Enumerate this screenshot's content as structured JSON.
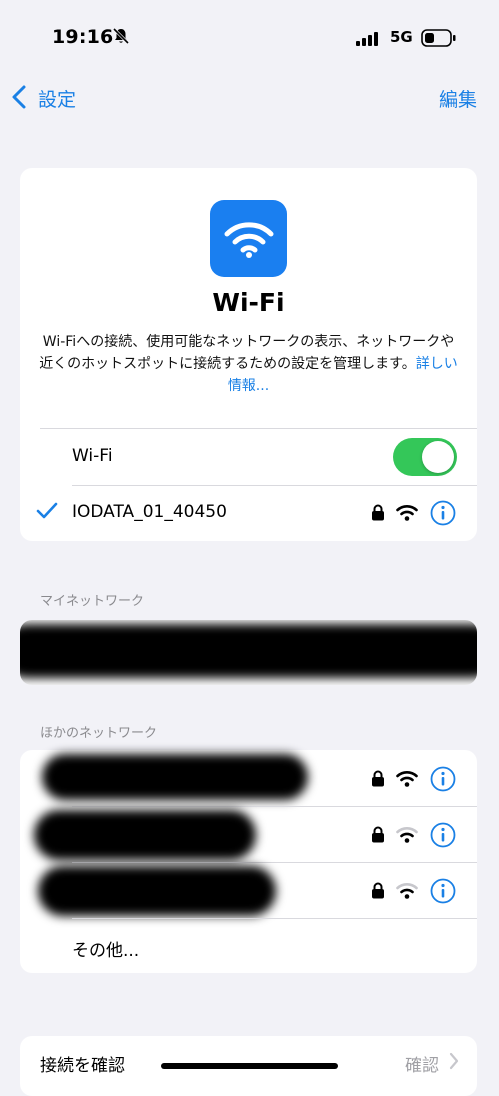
{
  "status_bar": {
    "time": "19:16",
    "network": "5G",
    "icons": [
      "bell-slash-icon",
      "cellular-signal-icon",
      "battery-icon"
    ]
  },
  "nav": {
    "back_label": "設定",
    "edit_label": "編集"
  },
  "wifi_header": {
    "title": "Wi-Fi",
    "description": "Wi-Fiへの接続、使用可能なネットワークの表示、ネットワークや近くのホットスポットに接続するための設定を管理します。",
    "more_info_link": "詳しい情報..."
  },
  "wifi_toggle": {
    "label": "Wi-Fi",
    "on": true
  },
  "connected_network": {
    "name": "IODATA_01_40450",
    "secured": true
  },
  "my_networks": {
    "header": "マイネットワーク"
  },
  "other_networks": {
    "header": "ほかのネットワーク",
    "other_label": "その他..."
  },
  "connection_check": {
    "label": "接続を確認",
    "value": "確認"
  },
  "colors": {
    "accent": "#1a80e5",
    "toggle_on": "#34c759",
    "background": "#f2f2f7",
    "secondary_text": "#8a8a8e"
  }
}
